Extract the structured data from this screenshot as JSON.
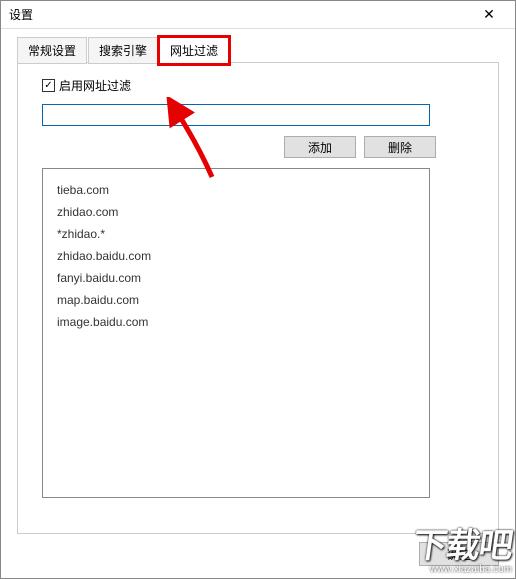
{
  "window": {
    "title": "设置",
    "close_glyph": "✕"
  },
  "tabs": [
    {
      "label": "常规设置"
    },
    {
      "label": "搜索引擎"
    },
    {
      "label": "网址过滤"
    }
  ],
  "filter": {
    "enable_label": "启用网址过滤",
    "enable_checked": true,
    "input_value": "",
    "add_label": "添加",
    "delete_label": "删除",
    "items": [
      "tieba.com",
      "zhidao.com",
      "*zhidao.*",
      "zhidao.baidu.com",
      "fanyi.baidu.com",
      "map.baidu.com",
      "image.baidu.com"
    ]
  },
  "footer": {
    "ok_label": "确定"
  },
  "watermark": {
    "text_main": "下载吧",
    "text_url": "www.xiazaiba.com"
  }
}
